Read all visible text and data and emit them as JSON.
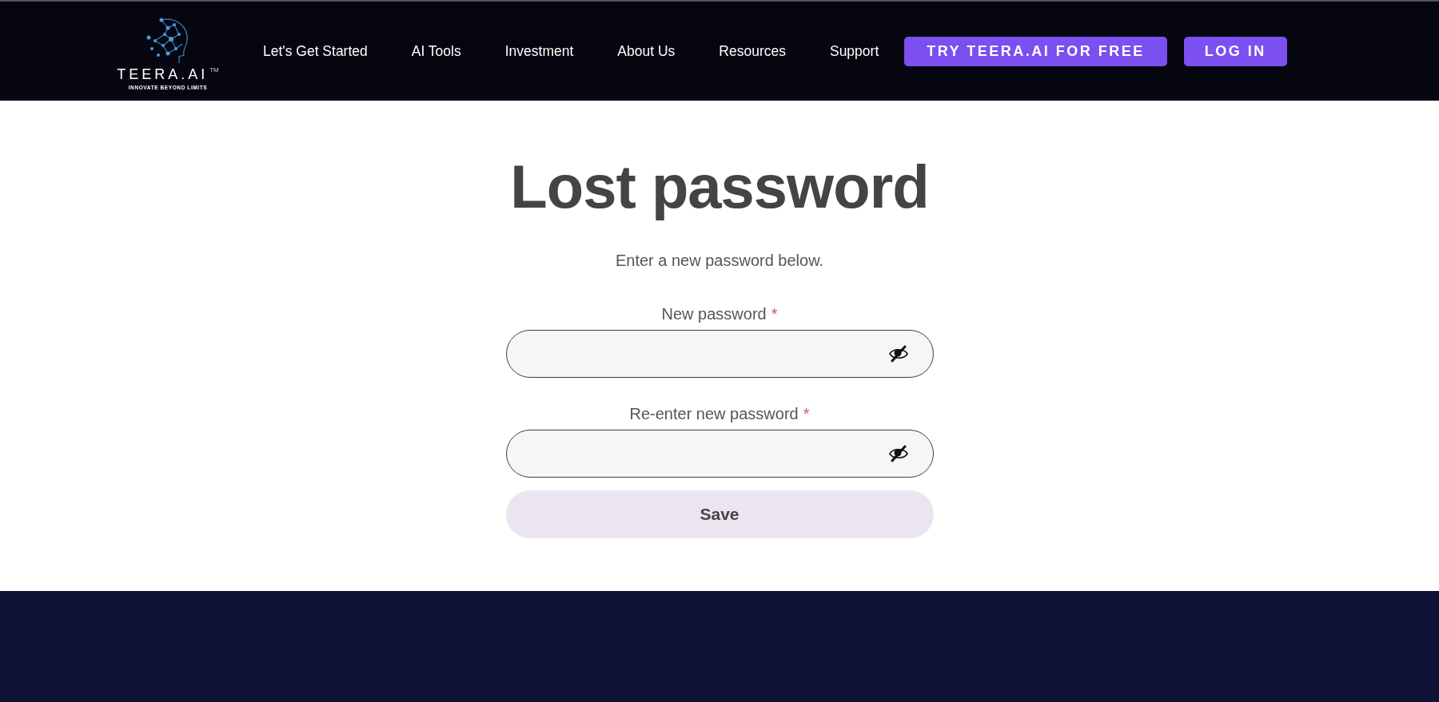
{
  "header": {
    "logo": {
      "name": "TEERA.AI",
      "mark": "TM",
      "tagline": "INNOVATE BEYOND LIMITS"
    },
    "nav": [
      "Let's Get Started",
      "AI Tools",
      "Investment",
      "About Us",
      "Resources",
      "Support"
    ],
    "buttons": [
      "TRY TEERA.AI FOR FREE",
      "LOG IN"
    ]
  },
  "form": {
    "title": "Lost password",
    "intro": "Enter a new password below.",
    "fields": [
      {
        "label": "New password",
        "required": "*",
        "masked": true
      },
      {
        "label": "Re-enter new password",
        "required": "*",
        "masked": true
      }
    ],
    "submit": "Save"
  },
  "footer": {
    "kind": "panel"
  }
}
